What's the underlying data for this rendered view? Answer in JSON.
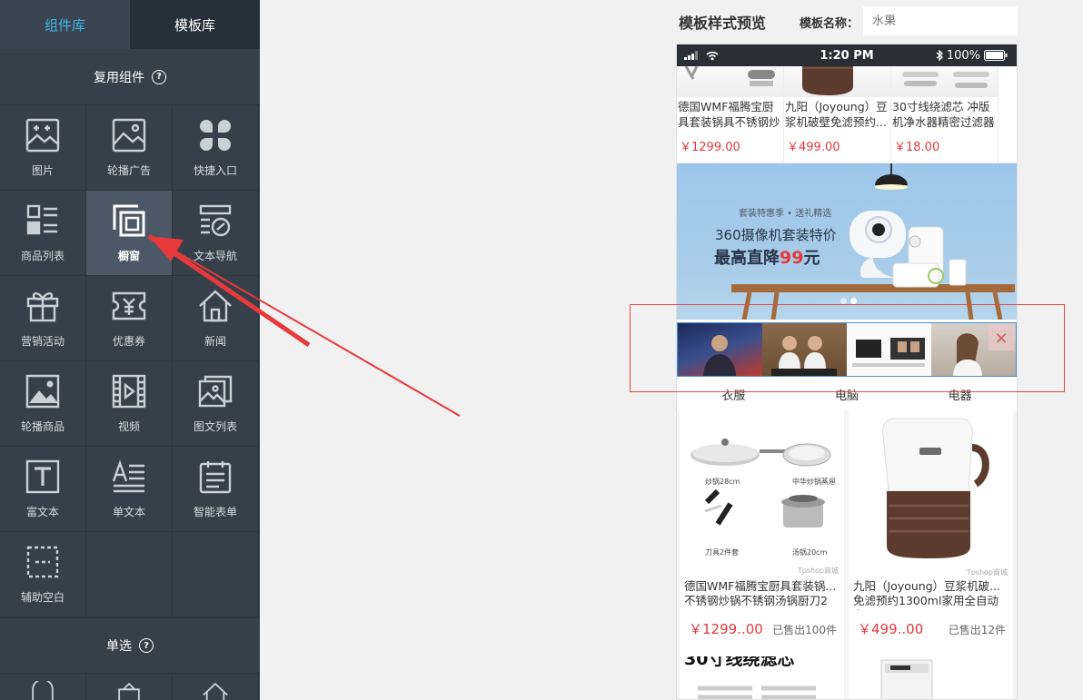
{
  "sidebar": {
    "tabs": [
      {
        "label": "组件库"
      },
      {
        "label": "模板库"
      }
    ],
    "section1_title": "复用组件",
    "section2_title": "单选",
    "help_icon": "?",
    "components": [
      {
        "label": "图片",
        "icon": "image-plus-icon"
      },
      {
        "label": "轮播广告",
        "icon": "carousel-image-icon"
      },
      {
        "label": "快捷入口",
        "icon": "clover-icon"
      },
      {
        "label": "商品列表",
        "icon": "list-icon"
      },
      {
        "label": "橱窗",
        "icon": "window-icon"
      },
      {
        "label": "文本导航",
        "icon": "text-link-icon"
      },
      {
        "label": "营销活动",
        "icon": "gift-icon"
      },
      {
        "label": "优惠券",
        "icon": "coupon-icon"
      },
      {
        "label": "新闻",
        "icon": "house-icon"
      },
      {
        "label": "轮播商品",
        "icon": "picture-icon"
      },
      {
        "label": "视频",
        "icon": "film-icon"
      },
      {
        "label": "图文列表",
        "icon": "photo-stack-icon"
      },
      {
        "label": "富文本",
        "icon": "text-t-icon"
      },
      {
        "label": "单文本",
        "icon": "text-lines-icon"
      },
      {
        "label": "智能表单",
        "icon": "form-icon"
      },
      {
        "label": "辅助空白",
        "icon": "dashed-box-icon"
      }
    ]
  },
  "preview": {
    "title": "模板样式预览",
    "tpl_name_label": "模板名称：",
    "tpl_name_placeholder": "水果"
  },
  "phone": {
    "time": "1:20 PM",
    "battery": "100%",
    "top_products": [
      {
        "name": "德国WMF福腾宝厨具套装锅具不锈钢炒锅...",
        "price": "￥1299.00"
      },
      {
        "name": "九阳（Joyoung）豆浆机破壁免滤预约...",
        "price": "￥499.00"
      },
      {
        "name": "30寸线绕滤芯 冲版机净水器精密过滤器各...",
        "price": "￥18.00"
      }
    ],
    "banner": {
      "sub": "套装特惠季 • 送礼精选",
      "line1": "360摄像机套装特价",
      "line2_prefix": "最高直降",
      "line2_num": "99",
      "line2_suffix": "元"
    },
    "categories": [
      "衣服",
      "电脑",
      "电器"
    ],
    "cards": [
      {
        "name": "德国WMF福腾宝厨具套装锅...不锈钢炒锅不锈钢汤锅厨刀2",
        "price": "￥1299..00",
        "sold": "已售出100件",
        "tags": [
          "炒锅28cm",
          "中华炒锅蒸屉",
          "刀具2件套",
          "汤锅20cm"
        ],
        "brand": "Tpshop商城"
      },
      {
        "name": "九阳（Joyoung）豆浆机破...免滤预约1300ml家用全自动多",
        "price": "￥499..00",
        "sold": "已售出12件",
        "brand": "Tpshop商城"
      }
    ],
    "bottom_card_title": "30寸线绕滤芯",
    "close_icon": "×"
  },
  "colors": {
    "accent": "#3fb6e8",
    "price": "#e4393c",
    "sidebar": "#36404a",
    "highlight": "#e04a4a"
  }
}
